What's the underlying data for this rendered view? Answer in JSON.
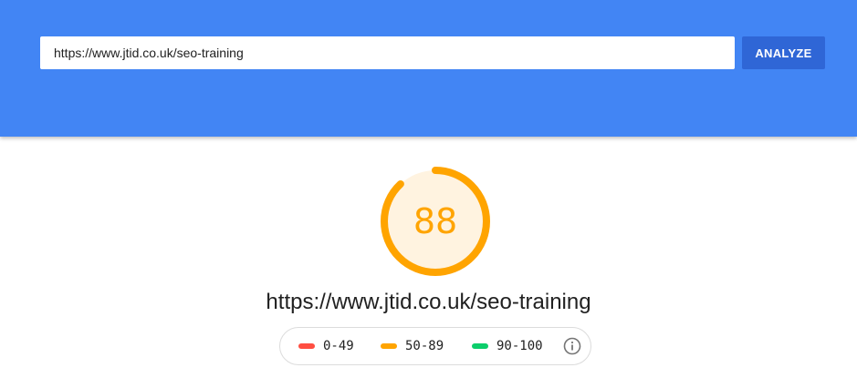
{
  "search": {
    "url_value": "https://www.jtid.co.uk/seo-training",
    "analyze_label": "ANALYZE"
  },
  "report": {
    "score": "88",
    "score_fraction": 0.88,
    "url": "https://www.jtid.co.uk/seo-training"
  },
  "legend": {
    "items": [
      {
        "label": "0-49",
        "color": "#ff4e42"
      },
      {
        "label": "50-89",
        "color": "#ffa400"
      },
      {
        "label": "90-100",
        "color": "#0cce6b"
      }
    ],
    "info_icon": "info-icon"
  },
  "colors": {
    "header": "#4285f4",
    "button": "#2f66d6",
    "score_average": "#ffa400",
    "score_bg": "#fff3e0"
  }
}
